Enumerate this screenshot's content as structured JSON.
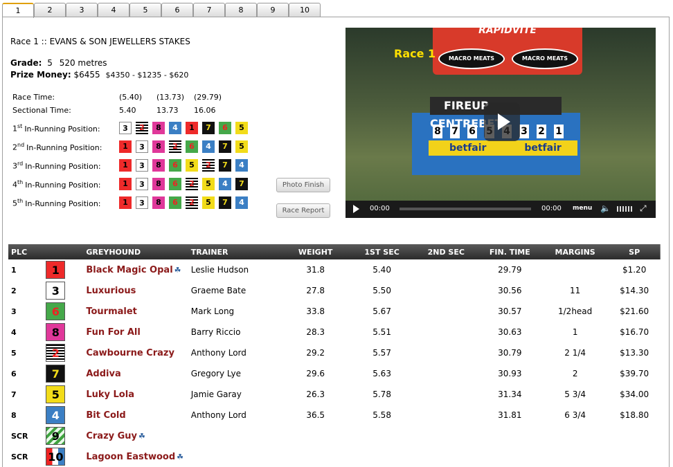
{
  "tabs": [
    "1",
    "2",
    "3",
    "4",
    "5",
    "6",
    "7",
    "8",
    "9",
    "10"
  ],
  "race": {
    "title": "Race 1 :: EVANS & SON JEWELLERS STAKES",
    "grade_label": "Grade:",
    "grade": "5",
    "distance": "520 metres",
    "prize_label": "Prize Money:",
    "prize_total": "$6455",
    "prize_split": "$4350 - $1235 - $620"
  },
  "timing": {
    "race_time_label": "Race Time:",
    "race_times": [
      "(5.40)",
      "(13.73)",
      "(29.79)"
    ],
    "sectional_label": "Sectional Time:",
    "sectional_times": [
      "5.40",
      "13.73",
      "16.06"
    ]
  },
  "in_running": [
    {
      "ord": "1",
      "sup": "st",
      "label": "In-Running Position:",
      "boxes": [
        3,
        2,
        8,
        4,
        1,
        7,
        6,
        5
      ]
    },
    {
      "ord": "2",
      "sup": "nd",
      "label": "In-Running Position:",
      "boxes": [
        1,
        3,
        8,
        2,
        6,
        4,
        7,
        5
      ]
    },
    {
      "ord": "3",
      "sup": "rd",
      "label": "In-Running Position:",
      "boxes": [
        1,
        3,
        8,
        6,
        5,
        2,
        7,
        4
      ]
    },
    {
      "ord": "4",
      "sup": "th",
      "label": "In-Running Position:",
      "boxes": [
        1,
        3,
        8,
        6,
        2,
        5,
        4,
        7
      ]
    },
    {
      "ord": "5",
      "sup": "th",
      "label": "In-Running Position:",
      "boxes": [
        1,
        3,
        8,
        6,
        2,
        5,
        7,
        4
      ]
    }
  ],
  "buttons": {
    "photo_finish": "Photo Finish",
    "race_report": "Race Report"
  },
  "video": {
    "overlay_race": "Race 1",
    "banner": "RAPIDVITE",
    "ovals": [
      "MACRO MEATS",
      "MACRO MEATS"
    ],
    "strip": "FIREUP CENTREBET",
    "board_numbers": [
      "8",
      "7",
      "6",
      "5",
      "4",
      "3",
      "2",
      "1"
    ],
    "betfair": [
      "betfair",
      "betfair"
    ],
    "time_current": "00:00",
    "time_total": "00:00",
    "menu": "menu"
  },
  "table": {
    "headers": [
      "PLC",
      "",
      "GREYHOUND",
      "TRAINER",
      "WEIGHT",
      "1ST SEC",
      "2ND SEC",
      "FIN. TIME",
      "MARGINS",
      "SP"
    ],
    "rows": [
      {
        "plc": "1",
        "box": 1,
        "name": "Black Magic Opal",
        "paw": true,
        "trainer": "Leslie Hudson",
        "weight": "31.8",
        "sec1": "5.40",
        "sec2": "",
        "fin": "29.79",
        "margin": "",
        "sp": "$1.20"
      },
      {
        "plc": "2",
        "box": 3,
        "name": "Luxurious",
        "paw": false,
        "trainer": "Graeme Bate",
        "weight": "27.8",
        "sec1": "5.50",
        "sec2": "",
        "fin": "30.56",
        "margin": "11",
        "sp": "$14.30"
      },
      {
        "plc": "3",
        "box": 6,
        "name": "Tourmalet",
        "paw": false,
        "trainer": "Mark Long",
        "weight": "33.8",
        "sec1": "5.67",
        "sec2": "",
        "fin": "30.57",
        "margin": "1/2head",
        "sp": "$21.60"
      },
      {
        "plc": "4",
        "box": 8,
        "name": "Fun For All",
        "paw": false,
        "trainer": "Barry Riccio",
        "weight": "28.3",
        "sec1": "5.51",
        "sec2": "",
        "fin": "30.63",
        "margin": "1",
        "sp": "$16.70"
      },
      {
        "plc": "5",
        "box": 2,
        "name": "Cawbourne Crazy",
        "paw": false,
        "trainer": "Anthony Lord",
        "weight": "29.2",
        "sec1": "5.57",
        "sec2": "",
        "fin": "30.79",
        "margin": "2 1/4",
        "sp": "$13.30"
      },
      {
        "plc": "6",
        "box": 7,
        "name": "Addiva",
        "paw": false,
        "trainer": "Gregory Lye",
        "weight": "29.6",
        "sec1": "5.63",
        "sec2": "",
        "fin": "30.93",
        "margin": "2",
        "sp": "$39.70"
      },
      {
        "plc": "7",
        "box": 5,
        "name": "Luky Lola",
        "paw": false,
        "trainer": "Jamie Garay",
        "weight": "26.3",
        "sec1": "5.78",
        "sec2": "",
        "fin": "31.34",
        "margin": "5 3/4",
        "sp": "$34.00"
      },
      {
        "plc": "8",
        "box": 4,
        "name": "Bit Cold",
        "paw": false,
        "trainer": "Anthony Lord",
        "weight": "36.5",
        "sec1": "5.58",
        "sec2": "",
        "fin": "31.81",
        "margin": "6 3/4",
        "sp": "$18.80"
      },
      {
        "plc": "SCR",
        "box": 9,
        "name": "Crazy Guy",
        "paw": true,
        "trainer": "",
        "weight": "",
        "sec1": "",
        "sec2": "",
        "fin": "",
        "margin": "",
        "sp": ""
      },
      {
        "plc": "SCR",
        "box": 10,
        "name": "Lagoon Eastwood",
        "paw": true,
        "trainer": "",
        "weight": "",
        "sec1": "",
        "sec2": "",
        "fin": "",
        "margin": "",
        "sp": ""
      }
    ]
  }
}
